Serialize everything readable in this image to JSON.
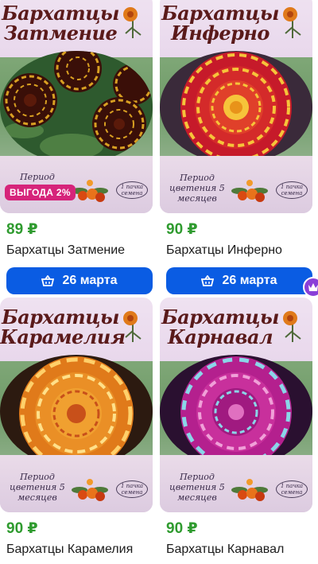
{
  "products": [
    {
      "image_title": "Бархатцы Затмение",
      "period_text": "Период цветения",
      "pack_text": "1 пачка\nсемена",
      "badge": "ВЫГОДА 2%",
      "price": "89 ₽",
      "name": "Бархатцы Затмение",
      "delivery": "26 марта",
      "flower_colors": [
        "#3a0f08",
        "#d9a022",
        "#1d3b1d"
      ]
    },
    {
      "image_title": "Бархатцы Инферно",
      "period_text": "Период цветения 5 месяцев",
      "pack_text": "1 пачка\nсемена",
      "badge": "",
      "price": "90 ₽",
      "name": "Бархатцы Инферно",
      "delivery": "26 марта",
      "flower_colors": [
        "#c61a2a",
        "#f6c43a",
        "#3a2a3a"
      ]
    },
    {
      "image_title": "Бархатцы Карамелия",
      "period_text": "Период цветения 5 месяцев",
      "pack_text": "1 пачка\nсемена",
      "badge": "",
      "price": "90 ₽",
      "name": "Бархатцы Карамелия",
      "delivery": "",
      "flower_colors": [
        "#e07a1a",
        "#ffd06a",
        "#2c1a10"
      ]
    },
    {
      "image_title": "Бархатцы Карнавал",
      "period_text": "Период цветения 5 месяцев",
      "pack_text": "1 пачка\nсемена",
      "badge": "",
      "price": "90 ₽",
      "name": "Бархатцы Карнавал",
      "delivery": "",
      "flower_colors": [
        "#b4208e",
        "#8ad6e8",
        "#2a1030"
      ]
    }
  ],
  "icons": {
    "cart": "basket-icon",
    "plus": "plus-badge-icon"
  },
  "colors": {
    "price": "#2f9b2f",
    "button": "#0a5ce3",
    "badge": "#d6247a",
    "plus": "#8a3fd8"
  }
}
